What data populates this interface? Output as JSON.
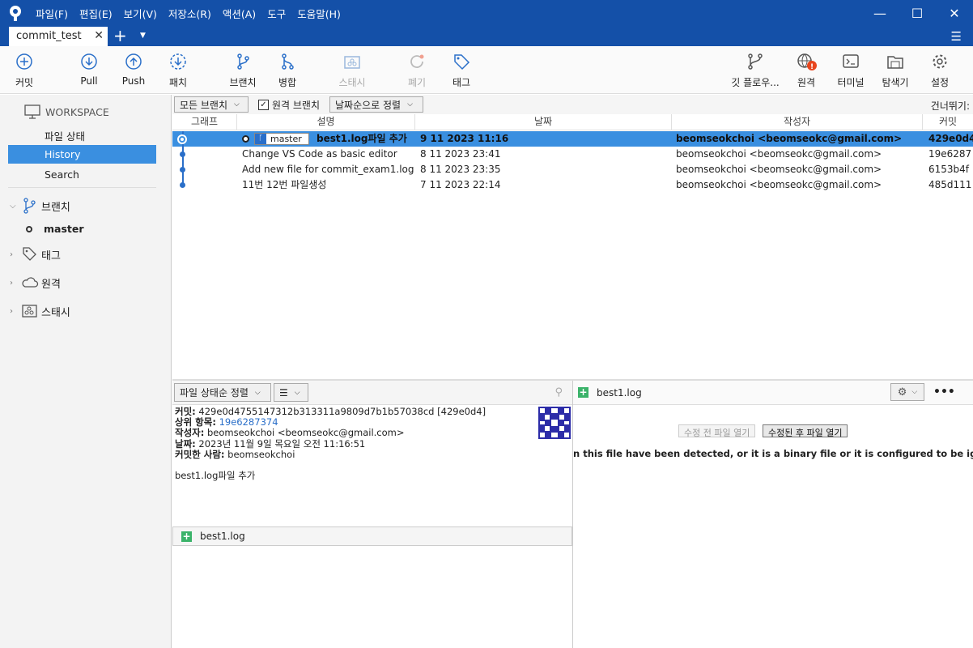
{
  "menu": [
    "파일(F)",
    "편집(E)",
    "보기(V)",
    "저장소(R)",
    "액션(A)",
    "도구",
    "도움말(H)"
  ],
  "tab": {
    "title": "commit_test"
  },
  "toolbar": {
    "commit": "커밋",
    "pull": "Pull",
    "push": "Push",
    "fetch": "패치",
    "branch": "브랜치",
    "merge": "병합",
    "stash": "스태시",
    "discard": "폐기",
    "tag": "태그",
    "gitflow": "깃 플로우...",
    "remote": "원격",
    "terminal": "터미널",
    "explorer": "탐색기",
    "settings": "설정"
  },
  "sidebar": {
    "workspace": "WORKSPACE",
    "items": [
      "파일 상태",
      "History",
      "Search"
    ],
    "sections": {
      "branches": "브랜치",
      "tags": "태그",
      "remotes": "원격",
      "stashes": "스태시"
    },
    "master": "master"
  },
  "filter": {
    "branches": "모든 브랜치",
    "remote_branches": "원격 브랜치",
    "sort": "날짜순으로 정렬",
    "skip": "건너뛰기:"
  },
  "columns": [
    "그래프",
    "설명",
    "날짜",
    "작성자",
    "커밋"
  ],
  "commits": [
    {
      "desc": "best1.log파일 추가",
      "date": "9 11 2023 11:16",
      "author": "beomseokchoi <beomseokc@gmail.com>",
      "hash": "429e0d4",
      "branch": "master"
    },
    {
      "desc": "Change VS Code as basic editor",
      "date": "8 11 2023 23:41",
      "author": "beomseokchoi <beomseokc@gmail.com>",
      "hash": "19e6287"
    },
    {
      "desc": "Add new file for commit_exam1.log",
      "date": "8 11 2023 23:35",
      "author": "beomseokchoi <beomseokc@gmail.com>",
      "hash": "6153b4f"
    },
    {
      "desc": "11번 12번 파일생성",
      "date": "7 11 2023 22:14",
      "author": "beomseokchoi <beomseokc@gmail.com>",
      "hash": "485d111"
    }
  ],
  "lower": {
    "sort": "파일 상태순 정렬",
    "details": {
      "commit_label": "커밋:",
      "commit_value": "429e0d4755147312b313311a9809d7b1b57038cd [429e0d4]",
      "parent_label": "상위 항목:",
      "parent_value": "19e6287374",
      "author_label": "작성자:",
      "author_value": "beomseokchoi <beomseokc@gmail.com>",
      "date_label": "날짜:",
      "date_value": "2023년 11월 9일 목요일 오전 11:16:51",
      "committer_label": "커밋한 사람:",
      "committer_value": "beomseokchoi",
      "message": "best1.log파일 추가"
    },
    "file": "best1.log"
  },
  "diff": {
    "file": "best1.log",
    "open_before": "수정 전 파일 열기",
    "open_after": "수정된 후 파일 열기",
    "message": "n this file have been detected, or it is a binary file or it is configured to be ignored by the"
  }
}
